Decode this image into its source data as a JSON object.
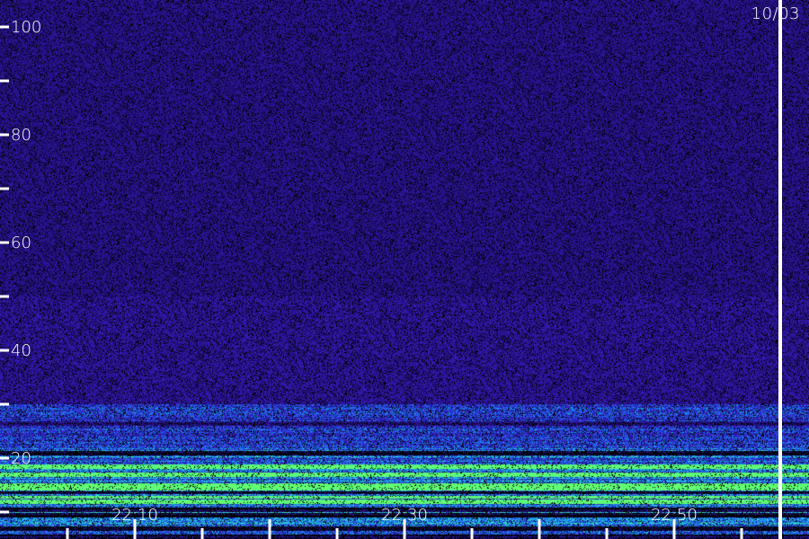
{
  "date_label": "10/03",
  "colors": {
    "background": "#000000",
    "noise_low": "#1a0a5e",
    "noise_high": "#3a22c8",
    "signal_mid": "#1f3fff",
    "signal_high": "#22d0d8",
    "signal_peak": "#5cff6a",
    "axis": "#ffffff"
  },
  "chart_data": {
    "type": "heatmap",
    "title": "",
    "xlabel": "",
    "ylabel": "",
    "x_tick_labels": [
      "22:10",
      "22:30",
      "22:50"
    ],
    "x_tick_minutes": [
      10,
      30,
      50
    ],
    "x_range_minutes": [
      0,
      58
    ],
    "x_marker_minute": 58,
    "y_tick_labels": [
      "20",
      "40",
      "60",
      "80",
      "100"
    ],
    "y_ticks": [
      20,
      40,
      60,
      80,
      100
    ],
    "y_minor_ticks": [
      10,
      30,
      50,
      70,
      90
    ],
    "ylim": [
      5,
      105
    ],
    "intensity_profile": {
      "low_band_top": 30,
      "strong_band_top": 22,
      "strong_bands": [
        12,
        13,
        14.5,
        15,
        17,
        18.5
      ],
      "dark_bands": [
        5.5,
        7,
        9.5,
        10.5,
        13.5,
        21,
        26.5
      ]
    }
  }
}
